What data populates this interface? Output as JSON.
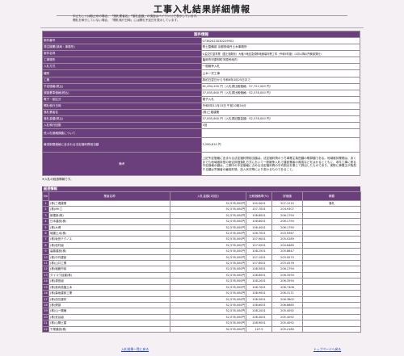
{
  "title": "工事入札結果詳細情報",
  "notes": [
    "中止もしくは取止めの場合、「落札業者名」「落札金額」の項目はハイフン(-)で表示しています。",
    "開札を執行していない場合、「開札執行日時」には開札予定日を表示しています。"
  ],
  "project": {
    "heading": "案件情報",
    "rows": [
      {
        "label": "案件番号",
        "value": "07382023030229902"
      },
      {
        "label": "発注機関(部局・事務所)",
        "value": "県土整備部 京都府南丹土木事務所"
      },
      {
        "label": "案件名称",
        "value": "公益交付金事業（国土強靭化）大堰川地区急傾斜地崩壊対策工事（令和5年度）（4月以降の所管部課分）"
      },
      {
        "label": "工事場所",
        "value": "亀岡市河原林町河原尻地内"
      },
      {
        "label": "入札方式",
        "value": "一般競争入札"
      },
      {
        "label": "種別",
        "value": "土木一式工事"
      },
      {
        "label": "工期",
        "value": "契約日翌日から令和6年3月25日まで"
      },
      {
        "label": "予定価格(税込)",
        "value": "61,494,200 円（入札書比較価格：57,722,000 円）"
      },
      {
        "label": "調査基準価格(税込)",
        "value": "57,835,800 円（入札書比較価格：52,578,000 円）"
      },
      {
        "label": "電子・紙区分",
        "value": "電子入札"
      },
      {
        "label": "開札執行日時",
        "value": "令和5年11月15日 午前10時34分"
      },
      {
        "label": "落札業者名",
        "value": "(株)三堀建業"
      },
      {
        "label": "落札金額(税込)",
        "value": "57,835,800 円（入札書記載金額：52,578,000 円）"
      },
      {
        "label": "入札執行回数",
        "value": "1回"
      },
      {
        "label": "低入札価格調査について",
        "value": ""
      },
      {
        "label": "最低制限価格に含まれる法定福利費相当額",
        "value": "2,280,810 円"
      },
      {
        "label": "備考",
        "value": "上記予定価格に含まれる法定福利費相当額は、法定福利費のうち事業主負担額の概算額である。地域維持業務は、あくまでも地域維持型の総合評価落札方式において一般競争入札で建設業者の育成などをはかるとともに、本件工事に係る予定価格の額は、工期中の予定価格に占める法定福利費の平均割合を乗じて算出したものであり、実際に事業主が負担する額は労働者の雇用形態、加入状況等により変わるものであること。"
      }
    ]
  },
  "bid_note": "※入札の経過情報です。",
  "bid_section_title": "経過情報",
  "bid_headers": {
    "no": "No",
    "name": "業者名称",
    "amount": "入札金額(1回目)",
    "ratio": "比較価格率(%)",
    "eval": "評価値",
    "remark": "摘要"
  },
  "bids": [
    {
      "no": "1",
      "name": "(株)三堀建業",
      "amount": "52,578,000円",
      "ratio": "100.0001",
      "eval": "207.1210",
      "remark": "落札"
    },
    {
      "no": "2",
      "name": "(株)MK工",
      "amount": "52,578,000円",
      "ratio": "107.7001",
      "eval": "204.9307",
      "remark": ""
    },
    {
      "no": "3",
      "name": "新建設(株)",
      "amount": "52,578,000円",
      "ratio": "108.8001",
      "eval": "206.1794",
      "remark": ""
    },
    {
      "no": "4",
      "name": "日本建設(株)",
      "amount": "52,578,000円",
      "ratio": "106.8001",
      "eval": "206.1794",
      "remark": ""
    },
    {
      "no": "5",
      "name": "(株)大博",
      "amount": "52,578,000円",
      "ratio": "106.4001",
      "eval": "206.1790",
      "remark": ""
    },
    {
      "no": "6",
      "name": "城建土木(株)",
      "amount": "52,578,000円",
      "ratio": "106.7001",
      "eval": "203.9367",
      "remark": ""
    },
    {
      "no": "7",
      "name": "(株)坂田テクノス",
      "amount": "52,578,000円",
      "ratio": "107.9001",
      "eval": "205.0289",
      "remark": ""
    },
    {
      "no": "8",
      "name": "(株)松村組",
      "amount": "52,578,000円",
      "ratio": "107.0001",
      "eval": "204.6485",
      "remark": ""
    },
    {
      "no": "9",
      "name": "高藤建設(株)",
      "amount": "52,578,000円",
      "ratio": "108.2501",
      "eval": "205.8647",
      "remark": ""
    },
    {
      "no": "10",
      "name": "(株)中丹建設",
      "amount": "52,578,000円",
      "ratio": "107.1001",
      "eval": "203.0075",
      "remark": ""
    },
    {
      "no": "11",
      "name": "(株)山口工業",
      "amount": "52,578,000円",
      "ratio": "107.6001",
      "eval": "203.0576",
      "remark": ""
    },
    {
      "no": "12",
      "name": "(株)塩飽市街",
      "amount": "52,578,000円",
      "ratio": "108.5001",
      "eval": "206.1794",
      "remark": ""
    },
    {
      "no": "13",
      "name": "ダイコウ技建(株)",
      "amount": "52,578,000円",
      "ratio": "108.6001",
      "eval": "206.3594",
      "remark": ""
    },
    {
      "no": "14",
      "name": "(株)源田組",
      "amount": "52,578,000円",
      "ratio": "108.2001",
      "eval": "206.3594",
      "remark": ""
    },
    {
      "no": "15",
      "name": "(株)奥尚造園土木",
      "amount": "52,578,000円",
      "ratio": "108.7001",
      "eval": "206.7406",
      "remark": ""
    },
    {
      "no": "16",
      "name": "(株)森坂建設工業",
      "amount": "52,578,000円",
      "ratio": "108.9001",
      "eval": "206.3171",
      "remark": ""
    },
    {
      "no": "17",
      "name": "(株)西辺建材",
      "amount": "52,578,000円",
      "ratio": "108.5001",
      "eval": "206.3602",
      "remark": ""
    },
    {
      "no": "18",
      "name": "(株)健部",
      "amount": "52,578,000円",
      "ratio": "108.6001",
      "eval": "206.6865",
      "remark": ""
    },
    {
      "no": "19",
      "name": "(株)山一陽庵",
      "amount": "52,578,000円",
      "ratio": "108.2001",
      "eval": "205.4092",
      "remark": ""
    },
    {
      "no": "20",
      "name": "(株)安谷組",
      "amount": "52,578,000円",
      "ratio": "108.4001",
      "eval": "205.4092",
      "remark": ""
    },
    {
      "no": "21",
      "name": "(株)山陽土建",
      "amount": "52,578,000円",
      "ratio": "108.9001",
      "eval": "205.4092",
      "remark": ""
    },
    {
      "no": "22",
      "name": "千尾建設(株)",
      "amount": "52,578,000円",
      "ratio": "107.9",
      "eval": "205.2180",
      "remark": ""
    }
  ],
  "nav": {
    "back": "入札結果一覧に戻る",
    "top": "トップページへ戻る"
  }
}
